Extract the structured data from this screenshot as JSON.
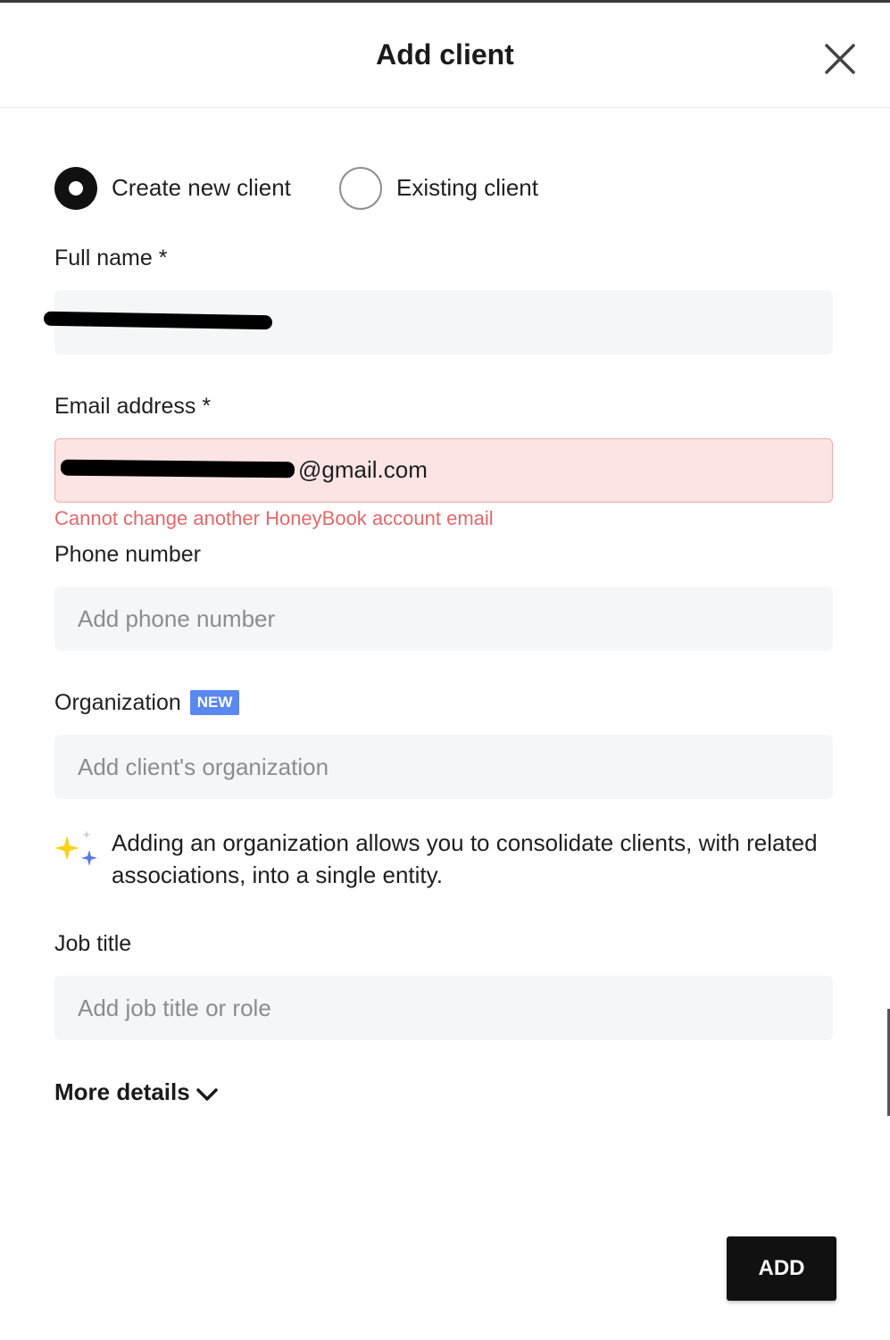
{
  "dialog": {
    "title": "Add client"
  },
  "client_type": {
    "options": [
      {
        "label": "Create new client",
        "selected": true
      },
      {
        "label": "Existing client",
        "selected": false
      }
    ]
  },
  "fields": {
    "full_name": {
      "label": "Full name *",
      "value": ""
    },
    "email": {
      "label": "Email address *",
      "value": "@gmail.com",
      "error": "Cannot change another HoneyBook account email"
    },
    "phone": {
      "label": "Phone number",
      "placeholder": "Add phone number"
    },
    "organization": {
      "label": "Organization",
      "badge": "NEW",
      "placeholder": "Add client's organization"
    },
    "job_title": {
      "label": "Job title",
      "placeholder": "Add job title or role"
    }
  },
  "info": {
    "text": "Adding an organization allows you to consolidate clients, with related associations, into a single entity.",
    "icon": "sparkle-icon"
  },
  "more_details": {
    "label": "More details",
    "icon": "chevron-down-icon"
  },
  "actions": {
    "add_label": "ADD"
  },
  "colors": {
    "error_text": "#e2696b",
    "error_bg": "#fde4e4",
    "badge_bg": "#5a87f0",
    "field_bg": "#f5f6f8",
    "sparkle_yellow": "#f7d31a",
    "sparkle_blue": "#5a78e8"
  }
}
